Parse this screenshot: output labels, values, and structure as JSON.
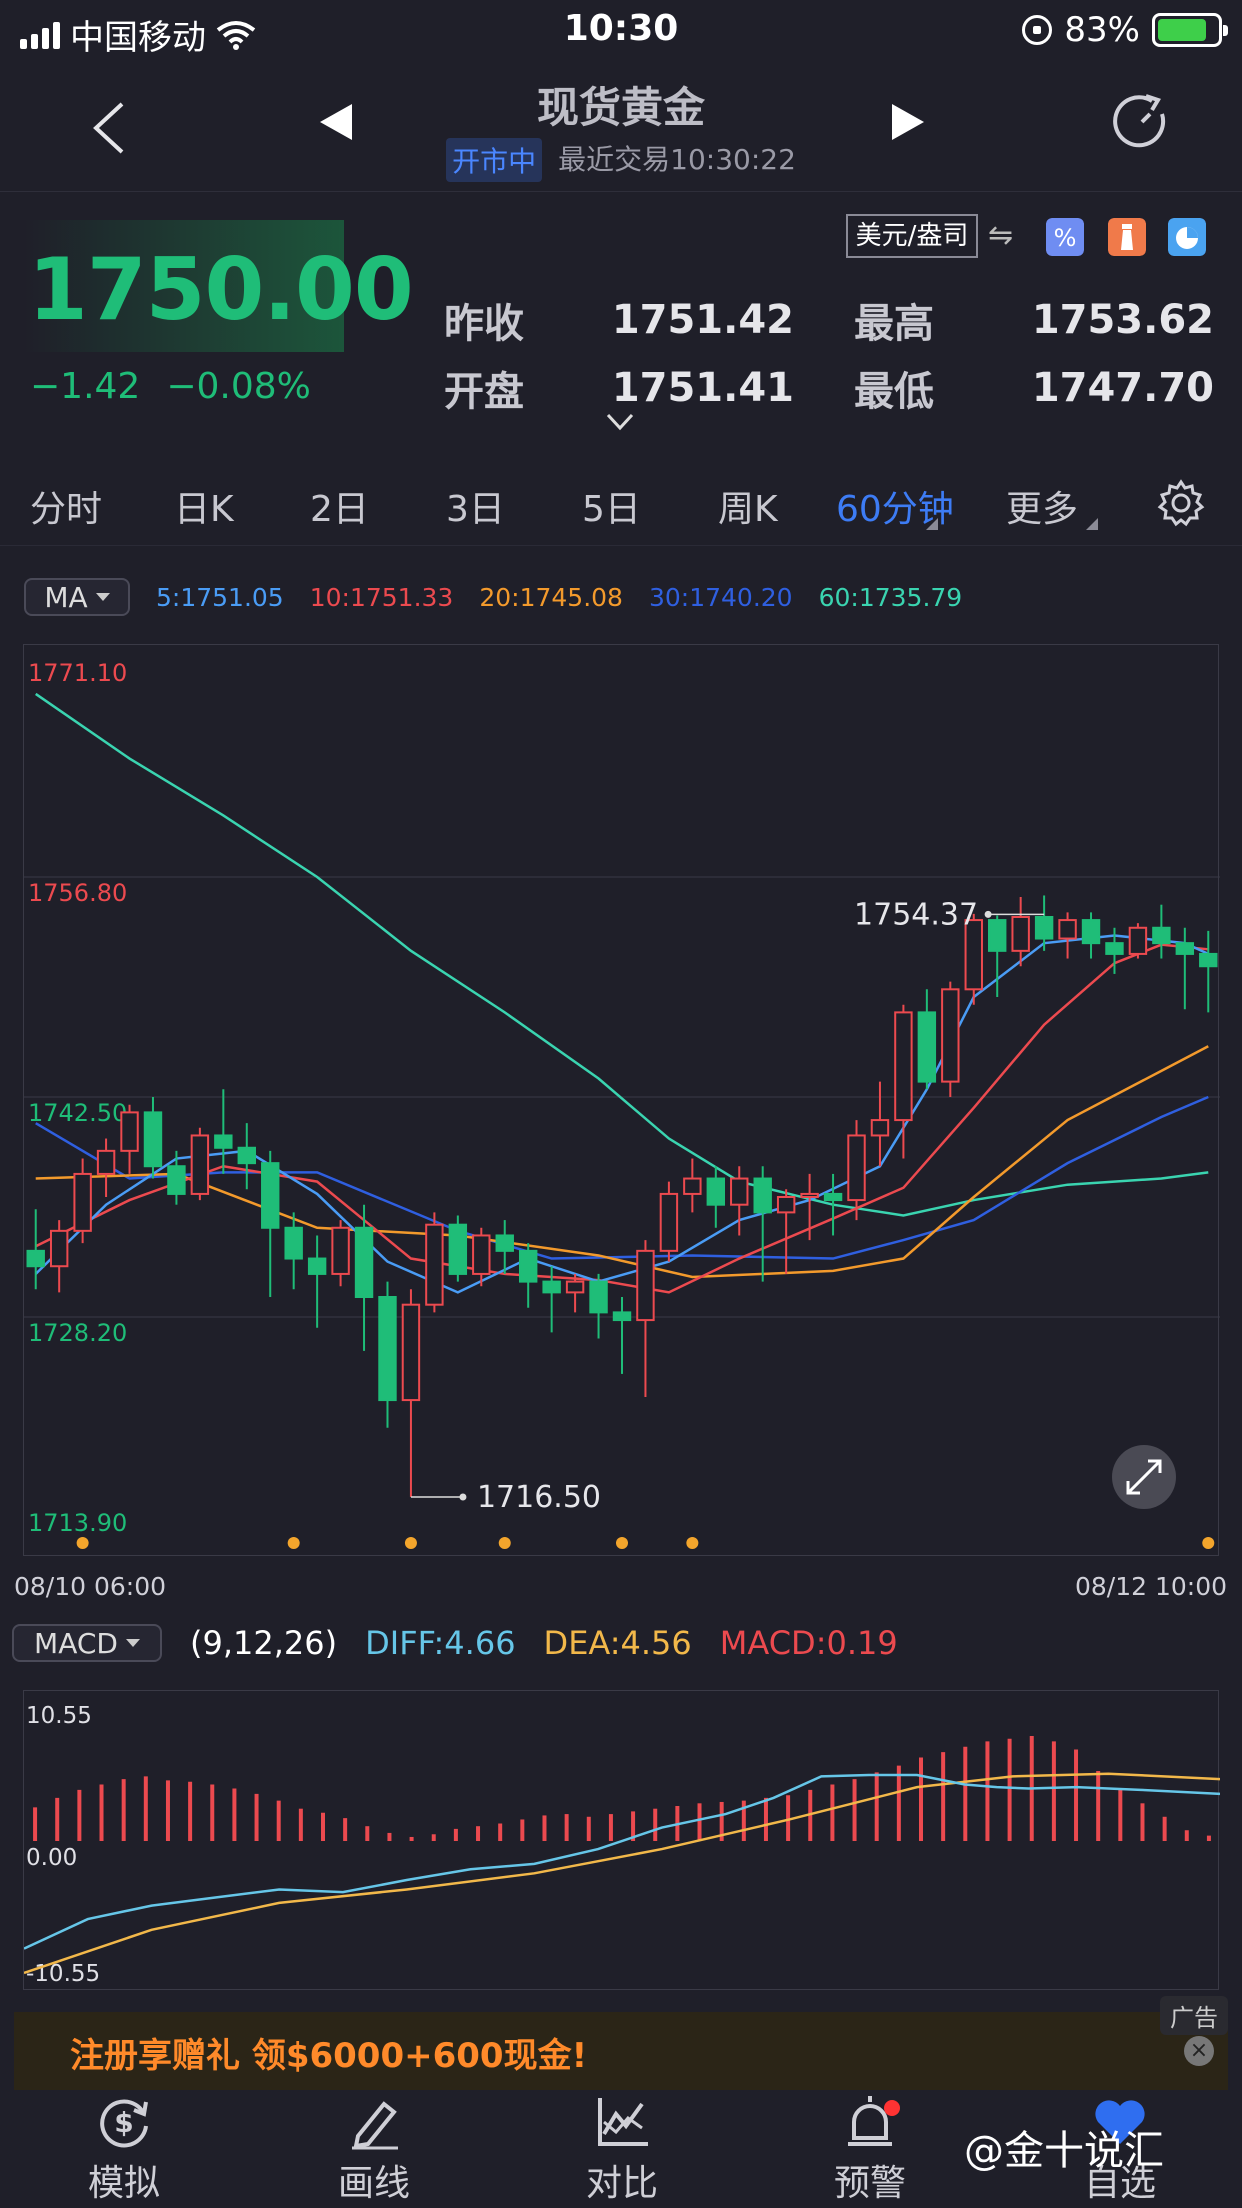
{
  "status": {
    "carrier": "中国移动",
    "time": "10:30",
    "battery": "83%"
  },
  "nav": {
    "title": "现货黄金",
    "badge": "开市中",
    "last_trade": "最近交易10:30:22"
  },
  "quote": {
    "price": "1750.00",
    "change": "−1.42",
    "change_pct": "−0.08%",
    "unit": "美元/盎司",
    "prev_close_label": "昨收",
    "prev_close": "1751.42",
    "open_label": "开盘",
    "open": "1751.41",
    "high_label": "最高",
    "high": "1753.62",
    "low_label": "最低",
    "low": "1747.70",
    "colors": {
      "down": "#1fbd78",
      "up": "#ec4a4f"
    }
  },
  "tabs": [
    "分时",
    "日K",
    "2日",
    "3日",
    "5日",
    "周K",
    "60分钟",
    "更多"
  ],
  "active_tab": "60分钟",
  "ma_legend": {
    "selector": "MA",
    "items": [
      {
        "label": "5:1751.05",
        "color": "#4a9cf5"
      },
      {
        "label": "10:1751.33",
        "color": "#ec4a4f"
      },
      {
        "label": "20:1745.08",
        "color": "#f39a2c"
      },
      {
        "label": "30:1740.20",
        "color": "#2f5fe0"
      },
      {
        "label": "60:1735.79",
        "color": "#3ad4b0"
      }
    ]
  },
  "chart_data": [
    {
      "type": "candlestick",
      "y_ticks": [
        "1771.10",
        "1756.80",
        "1742.50",
        "1728.20",
        "1713.90"
      ],
      "ylim": [
        1713.9,
        1771.1
      ],
      "x_start_label": "08/10 06:00",
      "x_end_label": "08/12 10:00",
      "max_marker": "1754.37",
      "min_marker": "1716.50",
      "candles": [
        [
          1732.5,
          1735.2,
          1730.0,
          1731.5
        ],
        [
          1731.5,
          1734.5,
          1729.8,
          1733.8
        ],
        [
          1733.8,
          1738.5,
          1733.0,
          1737.5
        ],
        [
          1737.5,
          1739.8,
          1736.0,
          1739.0
        ],
        [
          1739.0,
          1742.0,
          1737.5,
          1741.5
        ],
        [
          1741.5,
          1742.5,
          1737.2,
          1738.0
        ],
        [
          1738.0,
          1739.0,
          1735.5,
          1736.2
        ],
        [
          1736.2,
          1740.5,
          1735.8,
          1740.0
        ],
        [
          1740.0,
          1743.0,
          1737.5,
          1739.2
        ],
        [
          1739.2,
          1740.8,
          1736.5,
          1738.2
        ],
        [
          1738.2,
          1739.0,
          1729.5,
          1734.0
        ],
        [
          1734.0,
          1735.0,
          1730.0,
          1732.0
        ],
        [
          1732.0,
          1733.5,
          1727.5,
          1731.0
        ],
        [
          1731.0,
          1734.5,
          1730.2,
          1734.0
        ],
        [
          1734.0,
          1735.5,
          1726.0,
          1729.5
        ],
        [
          1729.5,
          1730.5,
          1721.0,
          1722.8
        ],
        [
          1722.8,
          1730.0,
          1716.5,
          1729.0
        ],
        [
          1729.0,
          1735.0,
          1728.5,
          1734.2
        ],
        [
          1734.2,
          1734.8,
          1730.5,
          1731.0
        ],
        [
          1731.0,
          1734.0,
          1730.2,
          1733.5
        ],
        [
          1733.5,
          1734.5,
          1731.0,
          1732.5
        ],
        [
          1732.5,
          1733.0,
          1728.8,
          1730.5
        ],
        [
          1730.5,
          1731.5,
          1727.2,
          1729.8
        ],
        [
          1729.8,
          1731.0,
          1728.5,
          1730.5
        ],
        [
          1730.5,
          1731.0,
          1726.8,
          1728.5
        ],
        [
          1728.5,
          1729.5,
          1724.5,
          1728.0
        ],
        [
          1728.0,
          1733.2,
          1723.0,
          1732.5
        ],
        [
          1732.5,
          1737.0,
          1731.8,
          1736.2
        ],
        [
          1736.2,
          1738.5,
          1735.0,
          1737.2
        ],
        [
          1737.2,
          1738.0,
          1734.0,
          1735.5
        ],
        [
          1735.5,
          1738.0,
          1733.5,
          1737.2
        ],
        [
          1737.2,
          1738.0,
          1730.5,
          1735.0
        ],
        [
          1735.0,
          1736.5,
          1731.0,
          1736.0
        ],
        [
          1736.0,
          1737.5,
          1733.2,
          1736.2
        ],
        [
          1736.2,
          1737.5,
          1733.5,
          1735.8
        ],
        [
          1735.8,
          1741.0,
          1734.5,
          1740.0
        ],
        [
          1740.0,
          1743.5,
          1738.0,
          1741.0
        ],
        [
          1741.0,
          1748.5,
          1738.5,
          1748.0
        ],
        [
          1748.0,
          1749.5,
          1743.0,
          1743.5
        ],
        [
          1743.5,
          1750.0,
          1742.5,
          1749.5
        ],
        [
          1749.5,
          1754.4,
          1748.5,
          1754.0
        ],
        [
          1754.0,
          1754.3,
          1749.0,
          1752.0
        ],
        [
          1752.0,
          1755.5,
          1751.0,
          1754.2
        ],
        [
          1754.2,
          1755.6,
          1752.0,
          1752.8
        ],
        [
          1752.8,
          1754.5,
          1751.5,
          1754.0
        ],
        [
          1754.0,
          1754.5,
          1751.5,
          1752.5
        ],
        [
          1752.5,
          1753.5,
          1750.5,
          1751.8
        ],
        [
          1751.8,
          1753.8,
          1751.5,
          1753.5
        ],
        [
          1753.5,
          1755.0,
          1751.5,
          1752.5
        ],
        [
          1752.5,
          1753.5,
          1748.2,
          1751.8
        ],
        [
          1751.8,
          1753.3,
          1748.0,
          1751.0
        ]
      ],
      "ma": {
        "ma5": [
          [
            0,
            1731.0
          ],
          [
            3,
            1735.5
          ],
          [
            6,
            1738.5
          ],
          [
            9,
            1739.0
          ],
          [
            12,
            1736.2
          ],
          [
            15,
            1731.8
          ],
          [
            18,
            1729.8
          ],
          [
            21,
            1732.0
          ],
          [
            24,
            1730.5
          ],
          [
            27,
            1731.8
          ],
          [
            30,
            1734.5
          ],
          [
            33,
            1735.8
          ],
          [
            36,
            1738.0
          ],
          [
            38,
            1743.0
          ],
          [
            40,
            1749.0
          ],
          [
            43,
            1752.5
          ],
          [
            46,
            1753.0
          ],
          [
            49,
            1752.5
          ],
          [
            50,
            1751.8
          ]
        ],
        "ma10": [
          [
            0,
            1732.8
          ],
          [
            4,
            1735.8
          ],
          [
            8,
            1738.0
          ],
          [
            12,
            1737.0
          ],
          [
            16,
            1732.0
          ],
          [
            20,
            1731.0
          ],
          [
            24,
            1730.6
          ],
          [
            27,
            1729.8
          ],
          [
            30,
            1732.0
          ],
          [
            34,
            1734.6
          ],
          [
            37,
            1736.6
          ],
          [
            40,
            1741.8
          ],
          [
            43,
            1747.2
          ],
          [
            46,
            1751.2
          ],
          [
            48,
            1752.4
          ],
          [
            50,
            1752.1
          ]
        ],
        "ma20": [
          [
            0,
            1737.2
          ],
          [
            6,
            1737.5
          ],
          [
            12,
            1734.0
          ],
          [
            18,
            1733.5
          ],
          [
            24,
            1732.2
          ],
          [
            28,
            1730.8
          ],
          [
            34,
            1731.2
          ],
          [
            37,
            1732.0
          ],
          [
            40,
            1736.0
          ],
          [
            44,
            1741.0
          ],
          [
            48,
            1744.2
          ],
          [
            50,
            1745.8
          ]
        ],
        "ma30": [
          [
            0,
            1740.8
          ],
          [
            4,
            1737.2
          ],
          [
            8,
            1737.6
          ],
          [
            12,
            1737.6
          ],
          [
            18,
            1733.8
          ],
          [
            22,
            1732.0
          ],
          [
            28,
            1732.2
          ],
          [
            34,
            1732.0
          ],
          [
            37,
            1733.2
          ],
          [
            40,
            1734.5
          ],
          [
            44,
            1738.2
          ],
          [
            48,
            1741.2
          ],
          [
            50,
            1742.5
          ]
        ],
        "ma60": [
          [
            0,
            1768.7
          ],
          [
            4,
            1764.5
          ],
          [
            8,
            1760.8
          ],
          [
            12,
            1756.8
          ],
          [
            16,
            1752.0
          ],
          [
            20,
            1748.0
          ],
          [
            24,
            1743.7
          ],
          [
            27,
            1739.8
          ],
          [
            30,
            1737.0
          ],
          [
            34,
            1735.5
          ],
          [
            37,
            1734.8
          ],
          [
            40,
            1735.8
          ],
          [
            44,
            1736.8
          ],
          [
            48,
            1737.2
          ],
          [
            50,
            1737.6
          ]
        ]
      },
      "x_markers": [
        2,
        11,
        16,
        20,
        25,
        28,
        50
      ]
    },
    {
      "type": "macd",
      "params": "(9,12,26)",
      "diff_label": "DIFF:4.66",
      "dea_label": "DEA:4.56",
      "macd_label": "MACD:0.19",
      "y_ticks": [
        "10.55",
        "0.00",
        "-10.55"
      ],
      "ylim": [
        -10.55,
        10.55
      ],
      "histogram": [
        2.5,
        3.2,
        3.8,
        4.2,
        4.6,
        4.8,
        4.5,
        4.4,
        4.2,
        3.9,
        3.5,
        3.0,
        2.4,
        2.1,
        1.7,
        1.1,
        0.6,
        0.3,
        0.5,
        0.9,
        1.1,
        1.3,
        1.6,
        1.9,
        2.0,
        1.8,
        2.0,
        2.2,
        2.4,
        2.6,
        2.8,
        2.9,
        3.0,
        3.2,
        3.4,
        3.8,
        4.2,
        4.6,
        5.1,
        5.6,
        6.2,
        6.6,
        7.0,
        7.4,
        7.6,
        7.8,
        7.4,
        6.8,
        5.2,
        3.8,
        2.8,
        1.8,
        0.8,
        0.4
      ],
      "diff": [
        [
          0,
          -8.0
        ],
        [
          4,
          -5.8
        ],
        [
          8,
          -4.8
        ],
        [
          12,
          -4.2
        ],
        [
          16,
          -3.6
        ],
        [
          20,
          -3.8
        ],
        [
          24,
          -2.9
        ],
        [
          28,
          -2.1
        ],
        [
          32,
          -1.7
        ],
        [
          36,
          -0.6
        ],
        [
          40,
          1.0
        ],
        [
          44,
          2.0
        ],
        [
          47,
          3.2
        ],
        [
          50,
          4.8
        ],
        [
          53,
          4.9
        ],
        [
          56,
          4.9
        ],
        [
          59,
          4.2
        ],
        [
          61,
          4.0
        ],
        [
          63,
          3.9
        ],
        [
          66,
          4.0
        ],
        [
          70,
          3.8
        ],
        [
          75,
          3.5
        ]
      ],
      "dea": [
        [
          0,
          -9.8
        ],
        [
          8,
          -6.6
        ],
        [
          16,
          -4.6
        ],
        [
          24,
          -3.6
        ],
        [
          32,
          -2.4
        ],
        [
          40,
          -0.6
        ],
        [
          48,
          1.6
        ],
        [
          56,
          4.0
        ],
        [
          62,
          4.8
        ],
        [
          68,
          5.0
        ],
        [
          75,
          4.6
        ]
      ]
    }
  ],
  "ad": {
    "text": "注册享赠礼 领$6000+600现金!",
    "tag": "广告"
  },
  "bottom_nav": [
    {
      "label": "模拟",
      "icon": "dollar-refresh-icon"
    },
    {
      "label": "画线",
      "icon": "pen-icon"
    },
    {
      "label": "对比",
      "icon": "compare-chart-icon"
    },
    {
      "label": "预警",
      "icon": "alarm-bell-icon"
    },
    {
      "label": "自选",
      "icon": "heart-icon"
    }
  ],
  "watermark": "@金十说汇"
}
